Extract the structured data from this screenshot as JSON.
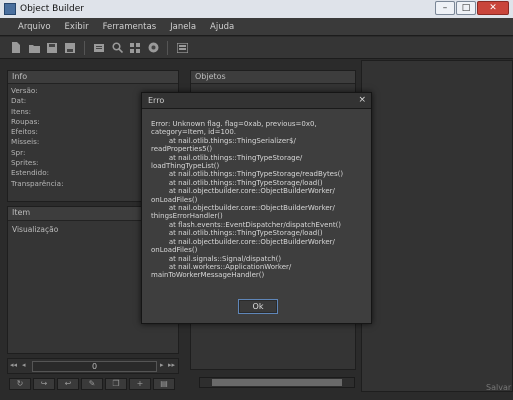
{
  "window": {
    "title": "Object Builder"
  },
  "menu": [
    "Arquivo",
    "Exibir",
    "Ferramentas",
    "Janela",
    "Ajuda"
  ],
  "toolbar_icons": [
    "new-icon",
    "open-icon",
    "save-icon",
    "save-as-icon",
    "compile-icon",
    "search-icon",
    "animation-editor-icon",
    "sprite-icon",
    "logo-icon"
  ],
  "info_panel": {
    "header": "Info",
    "rows": [
      "Versão:",
      "Dat:",
      "Itens:",
      "Roupas:",
      "Efeitos:",
      "Mísseis:",
      "Spr:",
      "Sprites:",
      "Estendido:",
      "Transparência:"
    ]
  },
  "item_panel": {
    "header": "Item",
    "visualization_label": "Visualização"
  },
  "objects_panel": {
    "header": "Objetos"
  },
  "pager": {
    "value": "0"
  },
  "right_panel": {
    "save_label": "Salvar"
  },
  "dialog": {
    "title": "Erro",
    "close": "×",
    "message": "Error: Unknown flag. flag=0xab, previous=0x0,\ncategory=Item, id=100.\n        at nail.otlib.things::ThingSerializer$/\nreadProperties5()\n        at nail.otlib.things::ThingTypeStorage/\nloadThingTypeList()\n        at nail.otlib.things::ThingTypeStorage/readBytes()\n        at nail.otlib.things::ThingTypeStorage/load()\n        at nail.objectbuilder.core::ObjectBuilderWorker/\nonLoadFiles()\n        at nail.objectbuilder.core::ObjectBuilderWorker/\nthingsErrorHandler()\n        at flash.events::EventDispatcher/dispatchEvent()\n        at nail.otlib.things::ThingTypeStorage/load()\n        at nail.objectbuilder.core::ObjectBuilderWorker/\nonLoadFiles()\n        at nail.signals::Signal/dispatch()\n        at nail.workers::ApplicationWorker/\nmainToWorkerMessageHandler()",
    "ok_label": "Ok"
  }
}
